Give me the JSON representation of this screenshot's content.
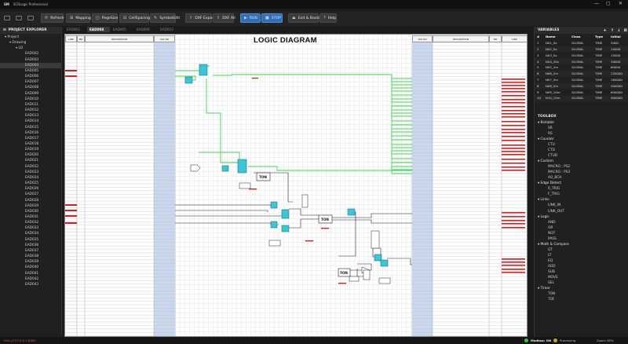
{
  "app": {
    "logo": "SM",
    "title": "SCRLogic Professional",
    "window_controls": [
      "—",
      "▢",
      "✕"
    ]
  },
  "toolbar": {
    "buttons": [
      {
        "label": "Refresh",
        "icon": "⟳"
      },
      {
        "label": "Mapping",
        "icon": "⊞"
      },
      {
        "label": "PageSize",
        "icon": "◰"
      },
      {
        "label": "CellSpacing",
        "icon": "⊟"
      },
      {
        "label": "SymbolEdit",
        "icon": "✎"
      },
      {
        "label": "DXF Export",
        "icon": "⇪"
      },
      {
        "label": "DXF All",
        "icon": "⇪"
      },
      {
        "label": "RUN",
        "icon": "▶"
      },
      {
        "label": "STOP",
        "icon": "■"
      },
      {
        "label": "Exit & Backup",
        "icon": "⏏"
      },
      {
        "label": "Help",
        "icon": "?"
      }
    ]
  },
  "project_explorer": {
    "title": "PROJECT EXPLORER",
    "root": "Project",
    "drawing": "Drawing",
    "group": "LD",
    "selected": "EAD004",
    "items": [
      "EAD002",
      "EAD003",
      "EAD004",
      "EAD005",
      "EAD006",
      "EAD007",
      "EAD008",
      "EAD009",
      "EAD010",
      "EAD011",
      "EAD012",
      "EAD013",
      "EAD014",
      "EAD015",
      "EAD016",
      "EAD017",
      "EAD018",
      "EAD019",
      "EAD020",
      "EAD021",
      "EAD022",
      "EAD023",
      "EAD024",
      "EAD025",
      "EAD026",
      "EAD027",
      "EAD028",
      "EAD029",
      "EAD030",
      "EAD031",
      "EAD032",
      "EAD033",
      "EAD034",
      "EAD035",
      "EAD036",
      "EAD037",
      "EAD038",
      "EAD039",
      "EAD040",
      "EAD041",
      "EAD042",
      "EAD043"
    ]
  },
  "tabs": [
    "EAD003",
    "EAD004",
    "EAD005",
    "EAD006",
    "EAD010"
  ],
  "active_tab": "EAD004",
  "diagram": {
    "title": "LOGIC DIAGRAM",
    "left_headers": {
      "link": "LINK",
      "no": "NO",
      "desc": "DESCRIPTION",
      "tag": "TAG NO"
    },
    "right_headers": {
      "tag": "TAG NO",
      "desc": "DESCRIPTION",
      "no": "NO",
      "link": "LINK"
    },
    "blocks": {
      "ton1": "TON",
      "ton2": "TON",
      "ton3": "TON"
    }
  },
  "variables": {
    "title": "VARIABLES",
    "columns": [
      "#",
      "Name",
      "Class",
      "Type",
      "Initial"
    ],
    "rows": [
      [
        "1",
        "N01_Sx",
        "GLOBAL",
        "TIME",
        "5000"
      ],
      [
        "2",
        "N02_Sx",
        "GLOBAL",
        "TIME",
        "10000"
      ],
      [
        "3",
        "N03_Sx",
        "GLOBAL",
        "TIME",
        "15000"
      ],
      [
        "4",
        "N04_30s",
        "GLOBAL",
        "TIME",
        "30000"
      ],
      [
        "5",
        "N05_1m",
        "GLOBAL",
        "TIME",
        "60000"
      ],
      [
        "6",
        "N06_2m",
        "GLOBAL",
        "TIME",
        "120000"
      ],
      [
        "7",
        "N07_3m",
        "GLOBAL",
        "TIME",
        "180000"
      ],
      [
        "8",
        "N08_5m",
        "GLOBAL",
        "TIME",
        "300000"
      ],
      [
        "9",
        "N09_10m",
        "GLOBAL",
        "TIME",
        "600000"
      ],
      [
        "10",
        "N10_15m",
        "GLOBAL",
        "TIME",
        "900000"
      ]
    ]
  },
  "toolbox": {
    "title": "TOOLBOX",
    "groups": [
      {
        "name": "Bistable",
        "items": [
          "SR",
          "RS"
        ]
      },
      {
        "name": "Counter",
        "items": [
          "CTU",
          "CTD",
          "CTUD"
        ]
      },
      {
        "name": "Custom",
        "items": [
          "MACRO : PS2",
          "MACRO : PS3",
          "AO_BCH"
        ]
      },
      {
        "name": "Edge Detect",
        "items": [
          "R_TRIG",
          "F_TRIG"
        ]
      },
      {
        "name": "Links",
        "items": [
          "LINK_IN",
          "LINK_OUT"
        ]
      },
      {
        "name": "Logic",
        "items": [
          "AND",
          "OR",
          "NOT",
          "PASS"
        ]
      },
      {
        "name": "Math & Compare",
        "items": [
          "GT",
          "LT",
          "EQ",
          "ADD",
          "SUB",
          "MOVE",
          "SEL"
        ]
      },
      {
        "name": "Timer",
        "items": [
          "TON",
          "TOF"
        ]
      }
    ]
  },
  "status": {
    "left": "http://127.0.0.1:8080",
    "modbus": "Modbus: ON",
    "state": "Processing",
    "zoom": "Zoom: 85%"
  },
  "colors": {
    "accent": "#2d6fb8",
    "wire_green": "#39d94a",
    "block_cyan": "#38c7d6",
    "link_red": "#d62020",
    "table_fill": "#c9d7ef"
  }
}
